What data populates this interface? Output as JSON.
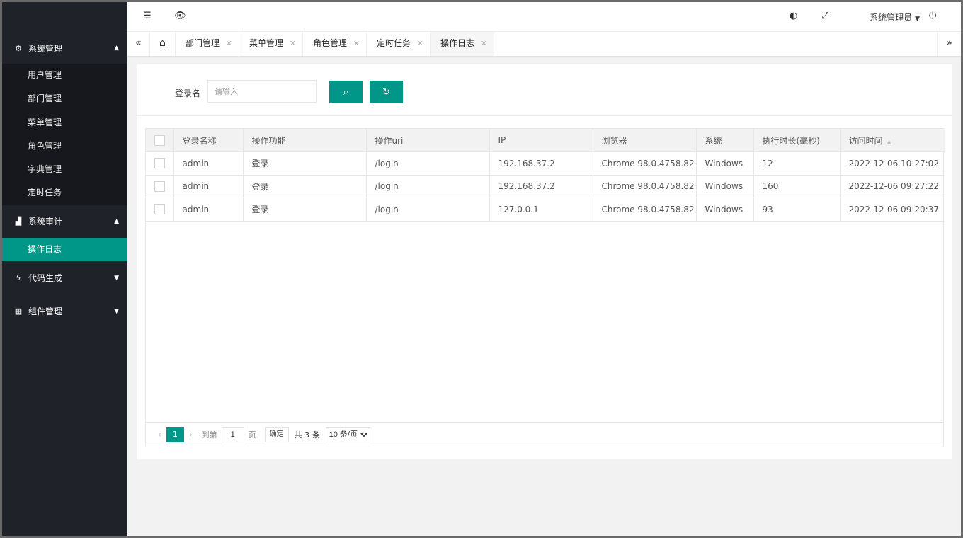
{
  "sidebar": {
    "groups": [
      {
        "label": "系统管理",
        "icon": "gears-icon",
        "expanded": true,
        "items": [
          "用户管理",
          "部门管理",
          "菜单管理",
          "角色管理",
          "字典管理",
          "定时任务"
        ]
      },
      {
        "label": "系统审计",
        "icon": "area-chart-icon",
        "expanded": true,
        "items": [
          "操作日志"
        ]
      },
      {
        "label": "代码生成",
        "icon": "bolt-icon",
        "expanded": false
      },
      {
        "label": "组件管理",
        "icon": "grid-icon",
        "expanded": false
      }
    ],
    "active_item": "操作日志"
  },
  "header": {
    "user": "系统管理员"
  },
  "tabs": [
    {
      "label": "部门管理"
    },
    {
      "label": "菜单管理"
    },
    {
      "label": "角色管理"
    },
    {
      "label": "定时任务"
    },
    {
      "label": "操作日志",
      "active": true
    }
  ],
  "search": {
    "label": "登录名",
    "placeholder": "请输入"
  },
  "table": {
    "columns": [
      "登录名称",
      "操作功能",
      "操作uri",
      "IP",
      "浏览器",
      "系统",
      "执行时长(毫秒)",
      "访问时间"
    ],
    "rows": [
      [
        "admin",
        "登录",
        "/login",
        "192.168.37.2",
        "Chrome 98.0.4758.82",
        "Windows",
        "12",
        "2022-12-06 10:27:02"
      ],
      [
        "admin",
        "登录",
        "/login",
        "192.168.37.2",
        "Chrome 98.0.4758.82",
        "Windows",
        "160",
        "2022-12-06 09:27:22"
      ],
      [
        "admin",
        "登录",
        "/login",
        "127.0.0.1",
        "Chrome 98.0.4758.82",
        "Windows",
        "93",
        "2022-12-06 09:20:37"
      ]
    ]
  },
  "pager": {
    "current": "1",
    "goto_label": "到第",
    "goto_value": "1",
    "page_unit": "页",
    "confirm": "确定",
    "total": "共 3 条",
    "page_size": "10 条/页"
  },
  "colors": {
    "accent": "#009688",
    "sidebar_bg": "#20222a",
    "submenu_bg": "#17181d"
  }
}
